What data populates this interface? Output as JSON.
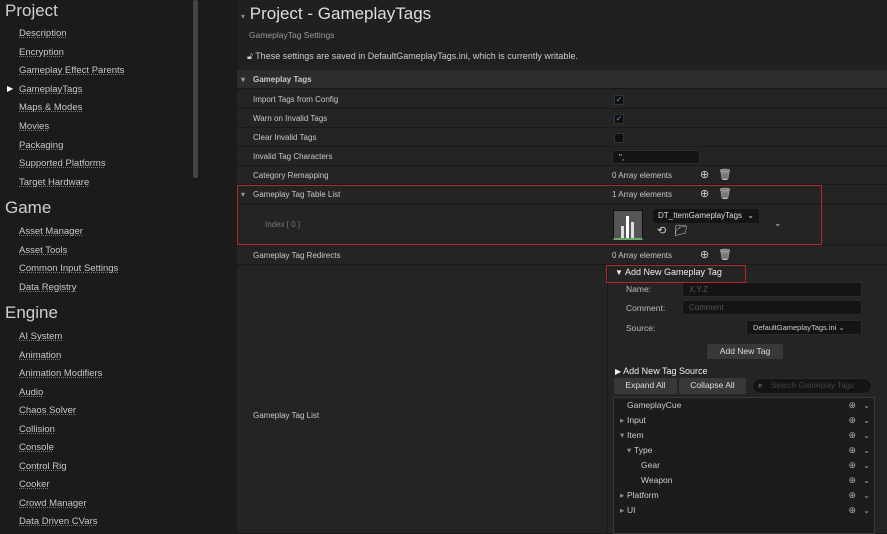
{
  "sidebar": {
    "project": {
      "title": "Project",
      "items": [
        "Description",
        "Encryption",
        "Gameplay Effect Parents",
        "GameplayTags",
        "Maps & Modes",
        "Movies",
        "Packaging",
        "Supported Platforms",
        "Target Hardware"
      ]
    },
    "game": {
      "title": "Game",
      "items": [
        "Asset Manager",
        "Asset Tools",
        "Common Input Settings",
        "Data Registry"
      ]
    },
    "engine": {
      "title": "Engine",
      "items": [
        "AI System",
        "Animation",
        "Animation Modifiers",
        "Audio",
        "Chaos Solver",
        "Collision",
        "Console",
        "Control Rig",
        "Cooker",
        "Crowd Manager",
        "Data Driven CVars"
      ]
    }
  },
  "main": {
    "title": "Project - GameplayTags",
    "subtitle": "GameplayTag Settings",
    "notice": "These settings are saved in DefaultGameplayTags.ini, which is currently writable.",
    "section": "Gameplay Tags",
    "rows": {
      "import": {
        "label": "Import Tags from Config",
        "checked": true
      },
      "warn": {
        "label": "Warn on Invalid Tags",
        "checked": true
      },
      "clear": {
        "label": "Clear Invalid Tags",
        "checked": false
      },
      "invalid_chars": {
        "label": "Invalid Tag Characters",
        "value": "\","
      },
      "remap": {
        "label": "Category Remapping",
        "value": "0 Array elements"
      },
      "table_list": {
        "label": "Gameplay Tag Table List",
        "value": "1 Array elements",
        "index": "Index [ 0 ]",
        "asset": "DT_ItemGameplayTags"
      },
      "redirects": {
        "label": "Gameplay Tag Redirects",
        "value": "0 Array elements"
      },
      "tag_list": {
        "label": "Gameplay Tag List"
      }
    },
    "add_tag": {
      "header": "Add New Gameplay Tag",
      "name_label": "Name:",
      "name_placeholder": "X.Y.Z",
      "comment_label": "Comment:",
      "comment_placeholder": "Comment",
      "source_label": "Source:",
      "source_value": "DefaultGameplayTags.ini",
      "add_button": "Add New Tag",
      "add_source": "Add New Tag Source",
      "expand_all": "Expand All",
      "collapse_all": "Collapse All",
      "search_placeholder": "Search Gameplay Tags"
    },
    "tree": [
      {
        "label": "GameplayCue",
        "depth": 0,
        "arrow": ""
      },
      {
        "label": "Input",
        "depth": 0,
        "arrow": "▸"
      },
      {
        "label": "Item",
        "depth": 0,
        "arrow": "▾"
      },
      {
        "label": "Type",
        "depth": 1,
        "arrow": "▾"
      },
      {
        "label": "Gear",
        "depth": 2,
        "arrow": ""
      },
      {
        "label": "Weapon",
        "depth": 2,
        "arrow": ""
      },
      {
        "label": "Platform",
        "depth": 0,
        "arrow": "▸"
      },
      {
        "label": "UI",
        "depth": 0,
        "arrow": "▸"
      }
    ]
  }
}
